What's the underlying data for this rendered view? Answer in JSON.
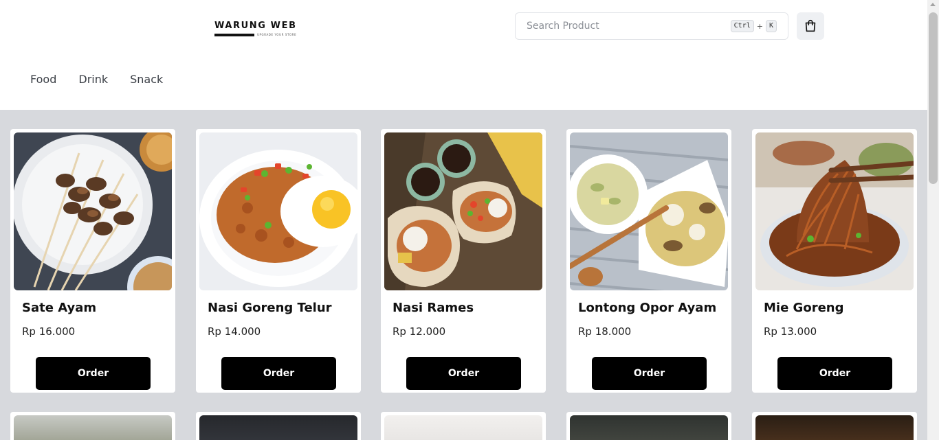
{
  "header": {
    "logo": {
      "title": "WARUNG WEB",
      "tagline": "UPGRADE YOUR STORE"
    },
    "search": {
      "placeholder": "Search Product",
      "shortcut_key1": "Ctrl",
      "shortcut_plus": "+",
      "shortcut_key2": "K"
    },
    "cart_icon": "shopping-bag-icon"
  },
  "nav": {
    "items": [
      {
        "label": "Food"
      },
      {
        "label": "Drink"
      },
      {
        "label": "Snack"
      }
    ]
  },
  "products": [
    {
      "name": "Sate Ayam",
      "price": "Rp 16.000",
      "order_label": "Order",
      "image": "sate-ayam-image"
    },
    {
      "name": "Nasi Goreng Telur",
      "price": "Rp 14.000",
      "order_label": "Order",
      "image": "nasi-goreng-telur-image"
    },
    {
      "name": "Nasi Rames",
      "price": "Rp 12.000",
      "order_label": "Order",
      "image": "nasi-rames-image"
    },
    {
      "name": "Lontong Opor Ayam",
      "price": "Rp 18.000",
      "order_label": "Order",
      "image": "lontong-opor-ayam-image"
    },
    {
      "name": "Mie Goreng",
      "price": "Rp 13.000",
      "order_label": "Order",
      "image": "mie-goreng-image"
    }
  ],
  "colors": {
    "page_bg": "#d7d9dd",
    "button_bg": "#000000",
    "button_text": "#ffffff"
  }
}
